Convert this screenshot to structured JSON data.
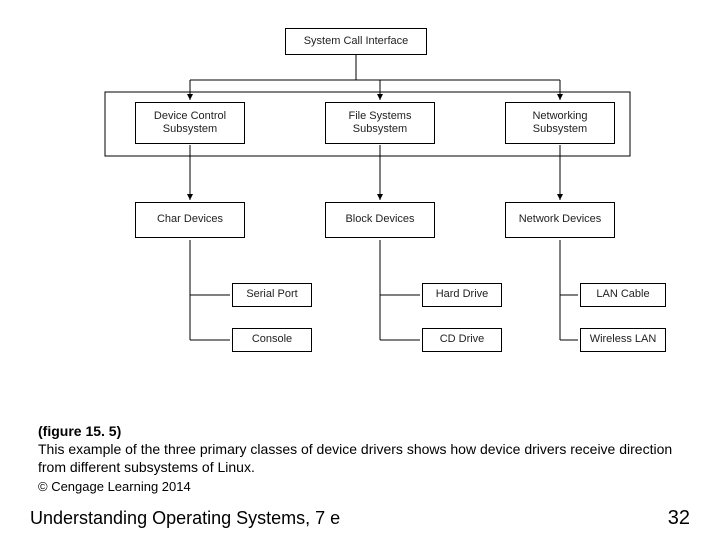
{
  "boxes": {
    "top": "System Call Interface",
    "sub1": "Device Control\nSubsystem",
    "sub2": "File Systems\nSubsystem",
    "sub3": "Networking\nSubsystem",
    "dev1": "Char Devices",
    "dev2": "Block Devices",
    "dev3": "Network Devices",
    "leaf1a": "Serial Port",
    "leaf1b": "Console",
    "leaf2a": "Hard Drive",
    "leaf2b": "CD Drive",
    "leaf3a": "LAN Cable",
    "leaf3b": "Wireless LAN"
  },
  "caption": {
    "label": "(figure 15. 5)",
    "text": "This example of the three primary classes of device drivers shows how device drivers receive direction from different subsystems of Linux.",
    "copyright": "© Cengage Learning 2014"
  },
  "footer": {
    "book": "Understanding Operating Systems, 7 e",
    "page": "32"
  }
}
